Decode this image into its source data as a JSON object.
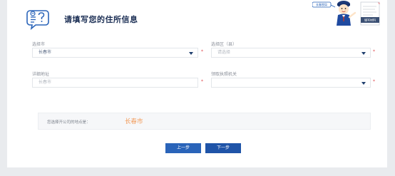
{
  "header": {
    "title": "请填写您的住所信息",
    "mascot_sign": "长春税局",
    "mascot_caption": "填写材料"
  },
  "form": {
    "city": {
      "label": "选择市",
      "value": "长春市",
      "required": "*"
    },
    "district": {
      "label": "选择区（县）",
      "placeholder": "请选择",
      "required": "*"
    },
    "address": {
      "label": "详细地址",
      "placeholder": "长春市",
      "required": "*"
    },
    "authority": {
      "label": "领取执照机关",
      "value": "",
      "required": "*"
    }
  },
  "summary": {
    "label": "您选择开公司的地点是：",
    "value": "长春市"
  },
  "buttons": {
    "prev": "上一步",
    "next": "下一步"
  },
  "colors": {
    "primary": "#2a64b9",
    "highlight": "#f29b5a",
    "required": "#e0474c",
    "title": "#1c2f55"
  }
}
